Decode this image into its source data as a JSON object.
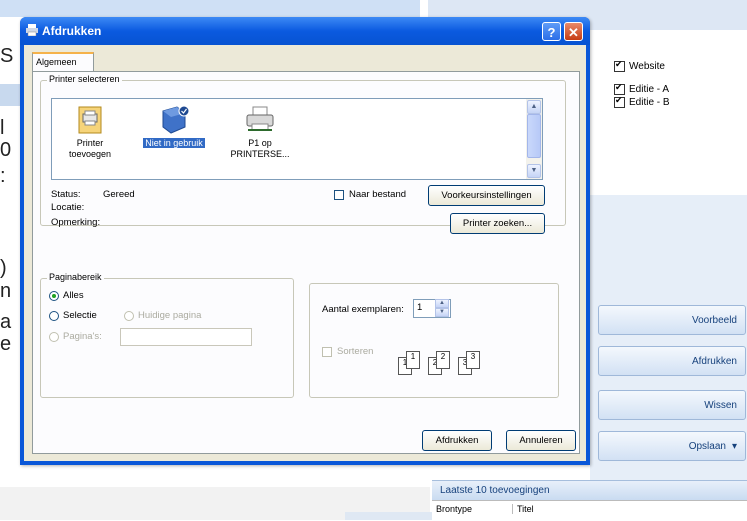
{
  "dialog": {
    "title": "Afdrukken",
    "tab_general": "Algemeen",
    "printer_group_label": "Printer selecteren",
    "printers": [
      {
        "name_line1": "Printer",
        "name_line2": "toevoegen",
        "icon": "add-printer-icon"
      },
      {
        "name_line1": "Niet in gebruik",
        "name_line2": "",
        "icon": "printer-shared-icon",
        "selected": true
      },
      {
        "name_line1": "P1 op",
        "name_line2": "PRINTERSE...",
        "icon": "network-printer-icon"
      }
    ],
    "status_label": "Status:",
    "status_value": "Gereed",
    "location_label": "Locatie:",
    "comment_label": "Opmerking:",
    "print_to_file_label": "Naar bestand",
    "preferences_button": "Voorkeursinstellingen",
    "find_printer_button": "Printer zoeken...",
    "page_range_label": "Paginabereik",
    "range_all": "Alles",
    "range_selection": "Selectie",
    "range_current": "Huidige pagina",
    "range_pages": "Pagina's:",
    "copies_label": "Aantal exemplaren:",
    "copies_value": "1",
    "collate_label": "Sorteren",
    "collate_pages": [
      "1",
      "1",
      "2",
      "2",
      "3",
      "3"
    ],
    "print_button": "Afdrukken",
    "cancel_button": "Annuleren"
  },
  "background": {
    "left_chars": [
      "S",
      "l",
      "0",
      ":",
      ")",
      "n",
      "a",
      "e"
    ],
    "checkboxes": [
      {
        "label": "Website",
        "checked": true
      },
      {
        "label": "Editie - A",
        "checked": true
      },
      {
        "label": "Editie - B",
        "checked": true
      }
    ],
    "buttons": [
      "Voorbeeld",
      "Afdrukken",
      "Wissen",
      "Opslaan"
    ],
    "save_dropdown_glyph": "▾",
    "recent_header": "Laatste 10 toevoegingen",
    "col_source": "Brontype",
    "col_title": "Titel"
  },
  "colors": {
    "titlebar": "#0b5ae0",
    "selection": "#316ac5",
    "dialog_face": "#ece9d8"
  }
}
